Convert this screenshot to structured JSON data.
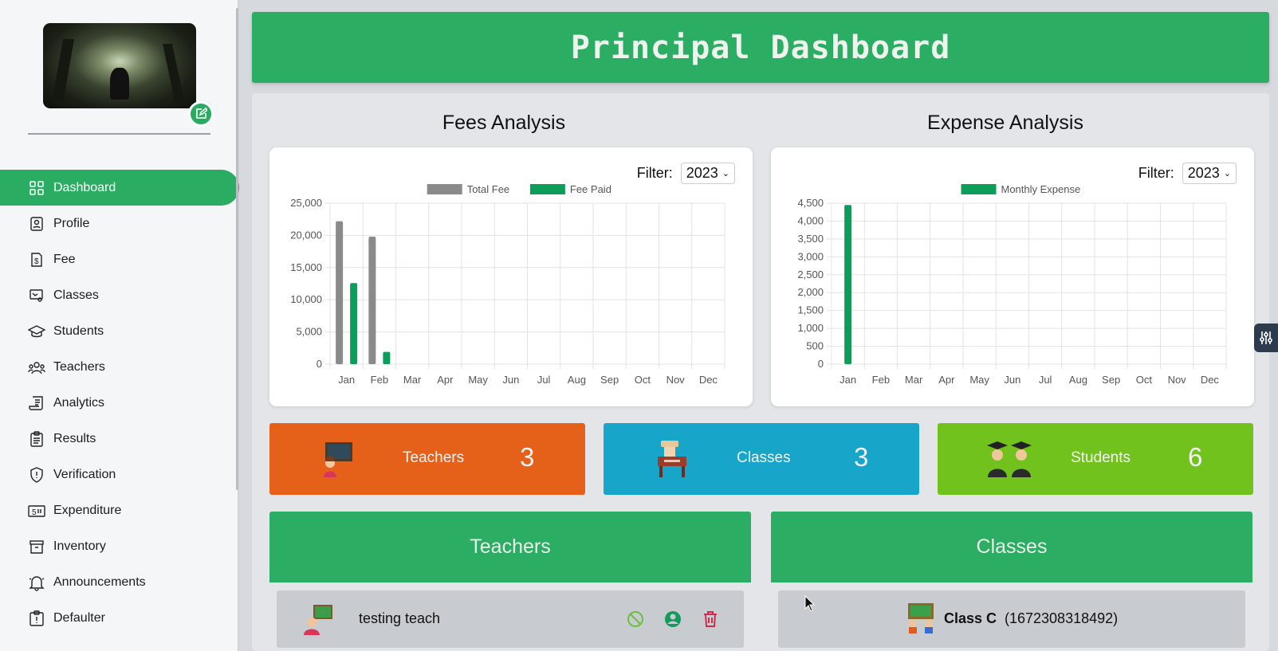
{
  "header": {
    "title": "Principal Dashboard"
  },
  "colors": {
    "brand_green": "#2bad63",
    "teachers_card": "#e5611a",
    "classes_card": "#17a6c9",
    "students_card": "#72c21d",
    "fee_total_bar": "#8a8a8a",
    "fee_paid_bar": "#0b9d59"
  },
  "sidebar": {
    "avatar": {
      "icon": "profile-image",
      "edit_icon": "pencil-square-icon"
    },
    "items": [
      {
        "label": "Dashboard",
        "icon": "grid-icon",
        "active": true
      },
      {
        "label": "Profile",
        "icon": "id-badge-icon"
      },
      {
        "label": "Fee",
        "icon": "dollar-document-icon"
      },
      {
        "label": "Classes",
        "icon": "classroom-board-icon"
      },
      {
        "label": "Students",
        "icon": "graduation-cap-icon"
      },
      {
        "label": "Teachers",
        "icon": "people-group-icon"
      },
      {
        "label": "Analytics",
        "icon": "report-icon"
      },
      {
        "label": "Results",
        "icon": "clipboard-icon"
      },
      {
        "label": "Verification",
        "icon": "shield-icon"
      },
      {
        "label": "Expenditure",
        "icon": "money-icon"
      },
      {
        "label": "Inventory",
        "icon": "archive-box-icon"
      },
      {
        "label": "Announcements",
        "icon": "bell-icon"
      },
      {
        "label": "Defaulter",
        "icon": "alert-document-icon"
      }
    ]
  },
  "fees": {
    "title": "Fees Analysis",
    "filter_label": "Filter:",
    "filter_value": "2023"
  },
  "expense": {
    "title": "Expense Analysis",
    "filter_label": "Filter:",
    "filter_value": "2023"
  },
  "chart_data": [
    {
      "type": "bar",
      "title": "Fees Analysis",
      "categories": [
        "Jan",
        "Feb",
        "Mar",
        "Apr",
        "May",
        "Jun",
        "Jul",
        "Aug",
        "Sep",
        "Oct",
        "Nov",
        "Dec"
      ],
      "series": [
        {
          "name": "Total Fee",
          "color": "#8a8a8a",
          "values": [
            22200,
            19800,
            0,
            0,
            0,
            0,
            0,
            0,
            0,
            0,
            0,
            0
          ]
        },
        {
          "name": "Fee Paid",
          "color": "#0b9d59",
          "values": [
            12600,
            1900,
            0,
            0,
            0,
            0,
            0,
            0,
            0,
            0,
            0,
            0
          ]
        }
      ],
      "ylim": [
        0,
        25000
      ],
      "yticks": [
        "0",
        "5,000",
        "10,000",
        "15,000",
        "20,000",
        "25,000"
      ],
      "grid": true,
      "legend": "top-center"
    },
    {
      "type": "bar",
      "title": "Expense Analysis",
      "categories": [
        "Jan",
        "Feb",
        "Mar",
        "Apr",
        "May",
        "Jun",
        "Jul",
        "Aug",
        "Sep",
        "Oct",
        "Nov",
        "Dec"
      ],
      "series": [
        {
          "name": "Monthly Expense",
          "color": "#0b9d59",
          "values": [
            4450,
            0,
            0,
            0,
            0,
            0,
            0,
            0,
            0,
            0,
            0,
            0
          ]
        }
      ],
      "ylim": [
        0,
        4500
      ],
      "yticks": [
        "0",
        "500",
        "1,000",
        "1,500",
        "2,000",
        "2,500",
        "3,000",
        "3,500",
        "4,000",
        "4,500"
      ],
      "grid": true,
      "legend": "top-center"
    }
  ],
  "stats": [
    {
      "label": "Teachers",
      "value": "3",
      "icon": "teacher-at-board-icon"
    },
    {
      "label": "Classes",
      "value": "3",
      "icon": "desk-icon"
    },
    {
      "label": "Students",
      "value": "6",
      "icon": "graduates-icon"
    }
  ],
  "teachers_list": {
    "title": "Teachers",
    "rows": [
      {
        "name": "testing teach",
        "icon": "teacher-icon",
        "actions": [
          "block-icon",
          "user-circle-icon",
          "trash-icon"
        ]
      }
    ]
  },
  "classes_list": {
    "title": "Classes",
    "rows": [
      {
        "name": "Class C",
        "code": "(1672308318492)",
        "icon": "classroom-icon"
      }
    ]
  }
}
